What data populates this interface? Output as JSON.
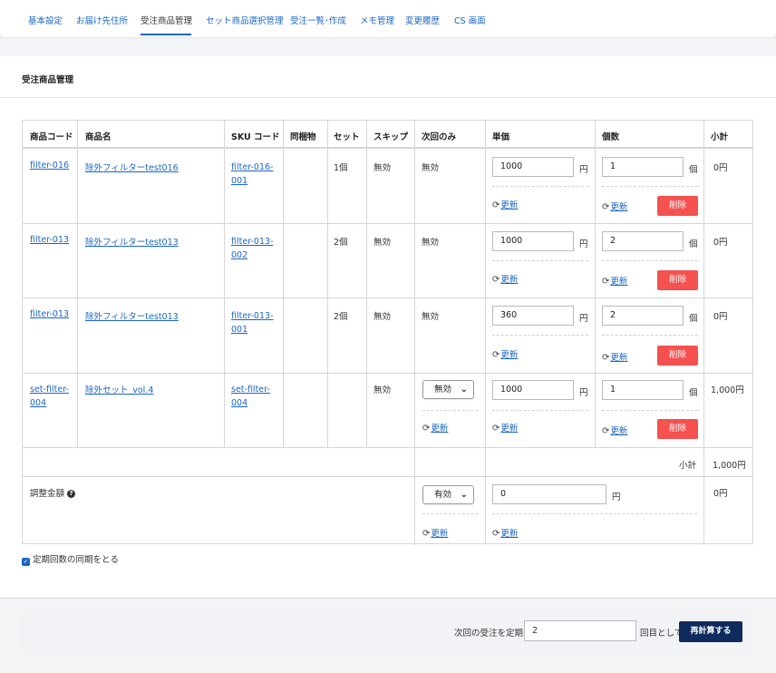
{
  "tabs": [
    {
      "label": "基本設定"
    },
    {
      "label": "お届け先住所"
    },
    {
      "label": "受注商品管理"
    },
    {
      "label": "セット商品選択管理"
    },
    {
      "label": "受注一覧･作成"
    },
    {
      "label": "メモ管理"
    },
    {
      "label": "変更履歴"
    },
    {
      "label": "CS 画面"
    }
  ],
  "section_title": "受注商品管理",
  "table": {
    "headers": {
      "code": "商品コード",
      "name": "商品名",
      "sku": "SKU コード",
      "bundle": "同梱物",
      "set": "セット",
      "skip": "スキップ",
      "next_only": "次回のみ",
      "unit_price": "単価",
      "qty": "個数",
      "subtotal": "小計"
    },
    "rows": [
      {
        "code": "filter-016",
        "name": "除外フィルターtest016",
        "sku": "filter-016-001",
        "set": "1個",
        "skip": "無効",
        "next_only": "無効",
        "price": "1000",
        "qty": "1",
        "subtotal": "0円"
      },
      {
        "code": "filter-013",
        "name": "除外フィルターtest013",
        "sku": "filter-013-002",
        "set": "2個",
        "skip": "無効",
        "next_only": "無効",
        "price": "1000",
        "qty": "2",
        "subtotal": "0円"
      },
      {
        "code": "filter-013",
        "name": "除外フィルターtest013",
        "sku": "filter-013-001",
        "set": "2個",
        "skip": "無効",
        "next_only": "無効",
        "price": "360",
        "qty": "2",
        "subtotal": "0円"
      },
      {
        "code": "set-filter-004",
        "name": "除外セット_vol.4",
        "sku": "set-filter-004",
        "set": "",
        "skip": "無効",
        "next_only_select": "無効",
        "price": "1000",
        "qty": "1",
        "subtotal": "1,000円"
      }
    ],
    "yen_unit": "円",
    "qty_unit": "個",
    "update_label": "更新",
    "delete_label": "削除",
    "subtotal_label": "小計",
    "subtotal_value": "1,000円",
    "adjust": {
      "label": "調整金額",
      "help_icon": "question-circle-icon",
      "select_value": "有効",
      "amount": "0",
      "unit": "円",
      "subtotal": "0円"
    }
  },
  "sync_checkbox": {
    "label": "定期回数の同期をとる",
    "checked": true
  },
  "footer": {
    "label_before": "次回の受注を定期",
    "value": "2",
    "label_after": "回目として",
    "button": "再計算する"
  },
  "colors": {
    "link": "#1a66c6",
    "delete": "#f4514f",
    "primary": "#0f2a5c"
  }
}
